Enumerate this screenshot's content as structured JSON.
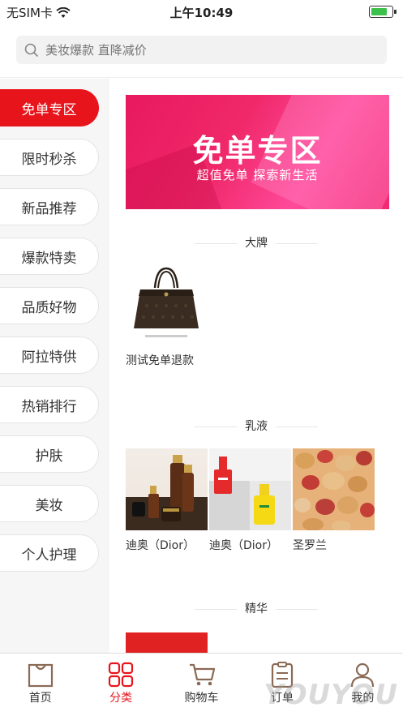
{
  "status_bar": {
    "carrier": "无SIM卡",
    "time": "上午10:49"
  },
  "search": {
    "placeholder": "美妆爆款 直降减价"
  },
  "sidebar": {
    "items": [
      {
        "label": "免单专区",
        "active": true
      },
      {
        "label": "限时秒杀"
      },
      {
        "label": "新品推荐"
      },
      {
        "label": "爆款特卖"
      },
      {
        "label": "品质好物"
      },
      {
        "label": "阿拉特供"
      },
      {
        "label": "热销排行"
      },
      {
        "label": "护肤"
      },
      {
        "label": "美妆"
      },
      {
        "label": "个人护理"
      }
    ]
  },
  "banner": {
    "title": "免单专区",
    "subtitle": "超值免单 探索新生活"
  },
  "sections": [
    {
      "title": "大牌",
      "products": [
        {
          "name": "测试免单退款",
          "icon": "handbag"
        }
      ]
    },
    {
      "title": "乳液",
      "products": [
        {
          "name": "迪奥（Dior）",
          "icon": "serum-bottles"
        },
        {
          "name": "迪奥（Dior）",
          "icon": "perfume-bottles"
        },
        {
          "name": "圣罗兰",
          "icon": "mixed-nuts"
        }
      ]
    },
    {
      "title": "精华",
      "products": []
    }
  ],
  "tabbar": {
    "items": [
      {
        "label": "首页",
        "icon": "bag-icon"
      },
      {
        "label": "分类",
        "icon": "grid-icon",
        "active": true
      },
      {
        "label": "购物车",
        "icon": "cart-icon"
      },
      {
        "label": "订单",
        "icon": "order-icon"
      },
      {
        "label": "我的",
        "icon": "person-icon"
      }
    ]
  },
  "watermark": "YOUYOU",
  "colors": {
    "accent": "#e8141b",
    "banner": "#f0286a"
  }
}
